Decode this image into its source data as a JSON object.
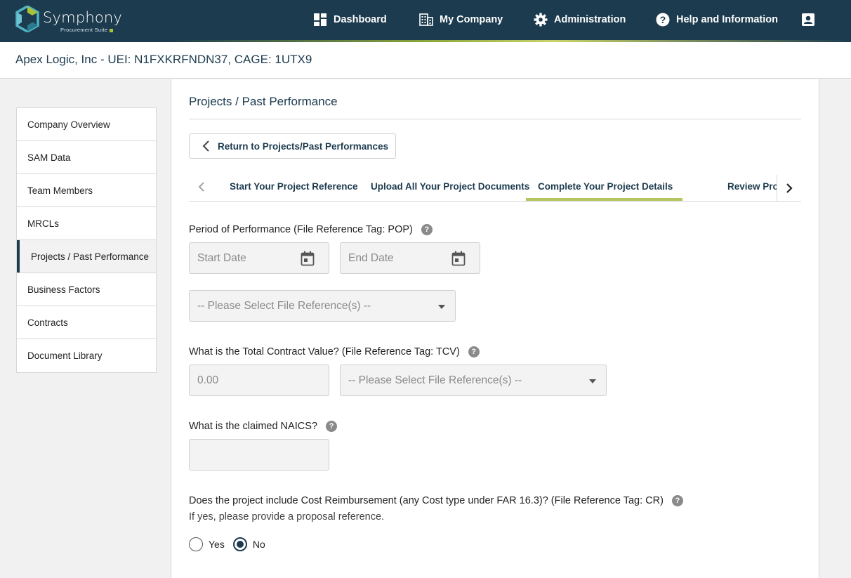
{
  "brand": {
    "name": "Symphony",
    "subtitle": "Procurement Suite"
  },
  "nav": {
    "dashboard": "Dashboard",
    "my_company": "My Company",
    "administration": "Administration",
    "help": "Help and Information"
  },
  "company": {
    "header": "Apex Logic, Inc - UEI: N1FXKRFNDN37, CAGE: 1UTX9"
  },
  "sidebar": {
    "items": [
      {
        "label": "Company Overview"
      },
      {
        "label": "SAM Data"
      },
      {
        "label": "Team Members"
      },
      {
        "label": "MRCLs"
      },
      {
        "label": "Projects / Past Performance",
        "active": true
      },
      {
        "label": "Business Factors"
      },
      {
        "label": "Contracts"
      },
      {
        "label": "Document Library"
      }
    ]
  },
  "page": {
    "title": "Projects / Past Performance",
    "return_label": "Return to Projects/Past Performances"
  },
  "tabs": {
    "items": [
      {
        "label": "Start Your Project Reference"
      },
      {
        "label": "Upload All Your Project Documents"
      },
      {
        "label": "Complete Your Project Details",
        "active": true
      },
      {
        "label": "Review Project"
      }
    ]
  },
  "form": {
    "pop": {
      "label": "Period of Performance (File Reference Tag: POP)",
      "start_placeholder": "Start Date",
      "end_placeholder": "End Date",
      "file_ref_placeholder": "-- Please Select File Reference(s) --"
    },
    "tcv": {
      "label": "What is the Total Contract Value? (File Reference Tag: TCV)",
      "value_placeholder": "0.00",
      "file_ref_placeholder": "-- Please Select File Reference(s) --"
    },
    "naics": {
      "label": "What is the claimed NAICS?",
      "value": ""
    },
    "cr": {
      "label": "Does the project include Cost Reimbursement (any Cost type under FAR 16.3)? (File Reference Tag: CR)",
      "sub_label": "If yes, please provide a proposal reference.",
      "options": [
        "Yes",
        "No"
      ],
      "selected": "No"
    }
  },
  "colors": {
    "nav_bg": "#1c3b4e",
    "accent": "#b6c561",
    "primary_text": "#1c3b4e"
  }
}
